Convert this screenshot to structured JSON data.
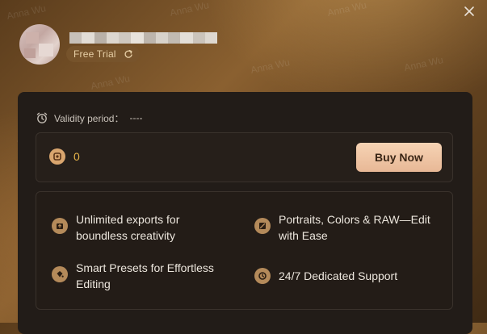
{
  "header": {
    "trial_label": "Free Trial",
    "close_icon": "close-icon",
    "refresh_icon": "refresh-icon"
  },
  "account": {
    "validity_label": "Validity period：",
    "validity_value": "----",
    "credits": "0",
    "buy_label": "Buy Now"
  },
  "features": [
    {
      "icon": "export-icon",
      "text": "Unlimited exports for boundless creativity"
    },
    {
      "icon": "edit-photo-icon",
      "text": "Portraits, Colors & RAW—Edit with Ease"
    },
    {
      "icon": "preset-bucket-icon",
      "text": "Smart Presets for Effortless Editing"
    },
    {
      "icon": "support-icon",
      "text": "24/7 Dedicated Support"
    }
  ],
  "watermark": "Anna Wu",
  "colors": {
    "accent": "#e8b54a",
    "button": "#f0c6a4",
    "panel": "#221c18",
    "badge": "#7a552d"
  }
}
